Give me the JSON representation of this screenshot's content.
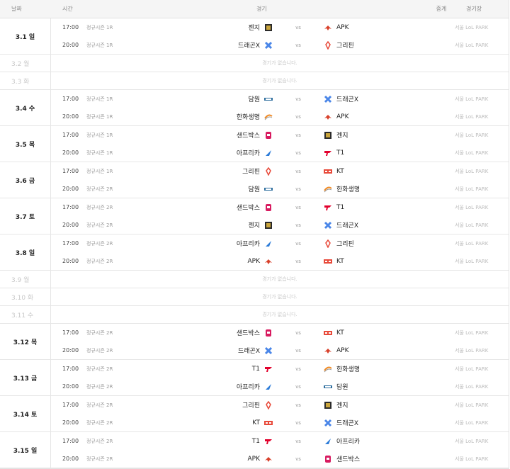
{
  "header": {
    "date": "날짜",
    "time": "시간",
    "match": "경기",
    "broadcast": "중계",
    "venue": "경기장"
  },
  "common": {
    "vs": "vs",
    "no_match": "경기가 없습니다.",
    "venue": "서울 LoL PARK"
  },
  "days": [
    {
      "date": "3.1 일",
      "games": [
        {
          "time": "17:00",
          "stage": "정규시즌 1R",
          "home": "젠지",
          "home_logo": "gen",
          "away": "APK",
          "away_logo": "apk"
        },
        {
          "time": "20:00",
          "stage": "정규시즌 1R",
          "home": "드래곤X",
          "home_logo": "drx",
          "away": "그리핀",
          "away_logo": "grf"
        }
      ]
    },
    {
      "date": "3.2 월",
      "games": []
    },
    {
      "date": "3.3 화",
      "games": []
    },
    {
      "date": "3.4 수",
      "games": [
        {
          "time": "17:00",
          "stage": "정규시즌 1R",
          "home": "담원",
          "home_logo": "dwg",
          "away": "드래곤X",
          "away_logo": "drx"
        },
        {
          "time": "20:00",
          "stage": "정규시즌 1R",
          "home": "한화생명",
          "home_logo": "hle",
          "away": "APK",
          "away_logo": "apk"
        }
      ]
    },
    {
      "date": "3.5 목",
      "games": [
        {
          "time": "17:00",
          "stage": "정규시즌 1R",
          "home": "샌드박스",
          "home_logo": "sb",
          "away": "젠지",
          "away_logo": "gen"
        },
        {
          "time": "20:00",
          "stage": "정규시즌 1R",
          "home": "아프리카",
          "home_logo": "af",
          "away": "T1",
          "away_logo": "t1"
        }
      ]
    },
    {
      "date": "3.6 금",
      "games": [
        {
          "time": "17:00",
          "stage": "정규시즌 1R",
          "home": "그리핀",
          "home_logo": "grf",
          "away": "KT",
          "away_logo": "kt"
        },
        {
          "time": "20:00",
          "stage": "정규시즌 2R",
          "home": "담원",
          "home_logo": "dwg",
          "away": "한화생명",
          "away_logo": "hle"
        }
      ]
    },
    {
      "date": "3.7 토",
      "games": [
        {
          "time": "17:00",
          "stage": "정규시즌 2R",
          "home": "샌드박스",
          "home_logo": "sb",
          "away": "T1",
          "away_logo": "t1"
        },
        {
          "time": "20:00",
          "stage": "정규시즌 2R",
          "home": "젠지",
          "home_logo": "gen",
          "away": "드래곤X",
          "away_logo": "drx"
        }
      ]
    },
    {
      "date": "3.8 일",
      "games": [
        {
          "time": "17:00",
          "stage": "정규시즌 2R",
          "home": "아프리카",
          "home_logo": "af",
          "away": "그리핀",
          "away_logo": "grf"
        },
        {
          "time": "20:00",
          "stage": "정규시즌 2R",
          "home": "APK",
          "home_logo": "apk",
          "away": "KT",
          "away_logo": "kt"
        }
      ]
    },
    {
      "date": "3.9 월",
      "games": []
    },
    {
      "date": "3.10 화",
      "games": []
    },
    {
      "date": "3.11 수",
      "games": []
    },
    {
      "date": "3.12 목",
      "games": [
        {
          "time": "17:00",
          "stage": "정규시즌 2R",
          "home": "샌드박스",
          "home_logo": "sb",
          "away": "KT",
          "away_logo": "kt"
        },
        {
          "time": "20:00",
          "stage": "정규시즌 2R",
          "home": "드래곤X",
          "home_logo": "drx",
          "away": "APK",
          "away_logo": "apk"
        }
      ]
    },
    {
      "date": "3.13 금",
      "games": [
        {
          "time": "17:00",
          "stage": "정규시즌 2R",
          "home": "T1",
          "home_logo": "t1",
          "away": "한화생명",
          "away_logo": "hle"
        },
        {
          "time": "20:00",
          "stage": "정규시즌 2R",
          "home": "아프리카",
          "home_logo": "af",
          "away": "담원",
          "away_logo": "dwg"
        }
      ]
    },
    {
      "date": "3.14 토",
      "games": [
        {
          "time": "17:00",
          "stage": "정규시즌 2R",
          "home": "그리핀",
          "home_logo": "grf",
          "away": "젠지",
          "away_logo": "gen"
        },
        {
          "time": "20:00",
          "stage": "정규시즌 2R",
          "home": "KT",
          "home_logo": "kt",
          "away": "드래곤X",
          "away_logo": "drx"
        }
      ]
    },
    {
      "date": "3.15 일",
      "games": [
        {
          "time": "17:00",
          "stage": "정규시즌 2R",
          "home": "T1",
          "home_logo": "t1",
          "away": "아프리카",
          "away_logo": "af"
        },
        {
          "time": "20:00",
          "stage": "정규시즌 2R",
          "home": "APK",
          "home_logo": "apk",
          "away": "샌드박스",
          "away_logo": "sb"
        }
      ]
    }
  ],
  "logos": {
    "gen": {
      "icon": "gen-g-logo-icon",
      "color": "#caa53c"
    },
    "apk": {
      "icon": "apk-prince-logo-icon",
      "color": "#d8402a"
    },
    "drx": {
      "icon": "dragonx-logo-icon",
      "color": "#4a86e8"
    },
    "grf": {
      "icon": "griffin-logo-icon",
      "color": "#e84a3a"
    },
    "dwg": {
      "icon": "damwon-logo-icon",
      "color": "#2f6f9f"
    },
    "hle": {
      "icon": "hanwha-life-logo-icon",
      "color": "#f08a24"
    },
    "sb": {
      "icon": "sandbox-logo-icon",
      "color": "#d81b60"
    },
    "af": {
      "icon": "afreeca-freecs-logo-icon",
      "color": "#2b7bd8"
    },
    "t1": {
      "icon": "t1-logo-icon",
      "color": "#e2012d"
    },
    "kt": {
      "icon": "kt-rolster-logo-icon",
      "color": "#e84a3a"
    }
  }
}
